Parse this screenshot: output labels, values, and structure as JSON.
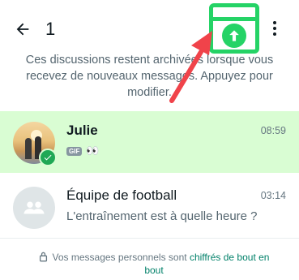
{
  "header": {
    "selected_count": "1",
    "back_icon": "arrow-left-icon",
    "unarchive_icon": "unarchive-icon",
    "more_icon": "more-vertical-icon"
  },
  "info": {
    "text": "Ces discussions restent archivées lorsque vous recevez de nouveaux messages. Appuyez pour modifier."
  },
  "chats": [
    {
      "name": "Julie",
      "time": "08:59",
      "preview_badge": "GIF",
      "preview_text": "👀",
      "selected": true
    },
    {
      "name": "Équipe de football",
      "time": "03:14",
      "preview_text": "L'entraînement est à quelle heure ?",
      "selected": false
    }
  ],
  "footer": {
    "text": "Vos messages personnels sont ",
    "link": "chiffrés de bout en bout"
  },
  "colors": {
    "accent": "#25d366",
    "selected_bg": "#d9fdd3",
    "annotation_arrow": "#f0434a",
    "link": "#008069"
  }
}
